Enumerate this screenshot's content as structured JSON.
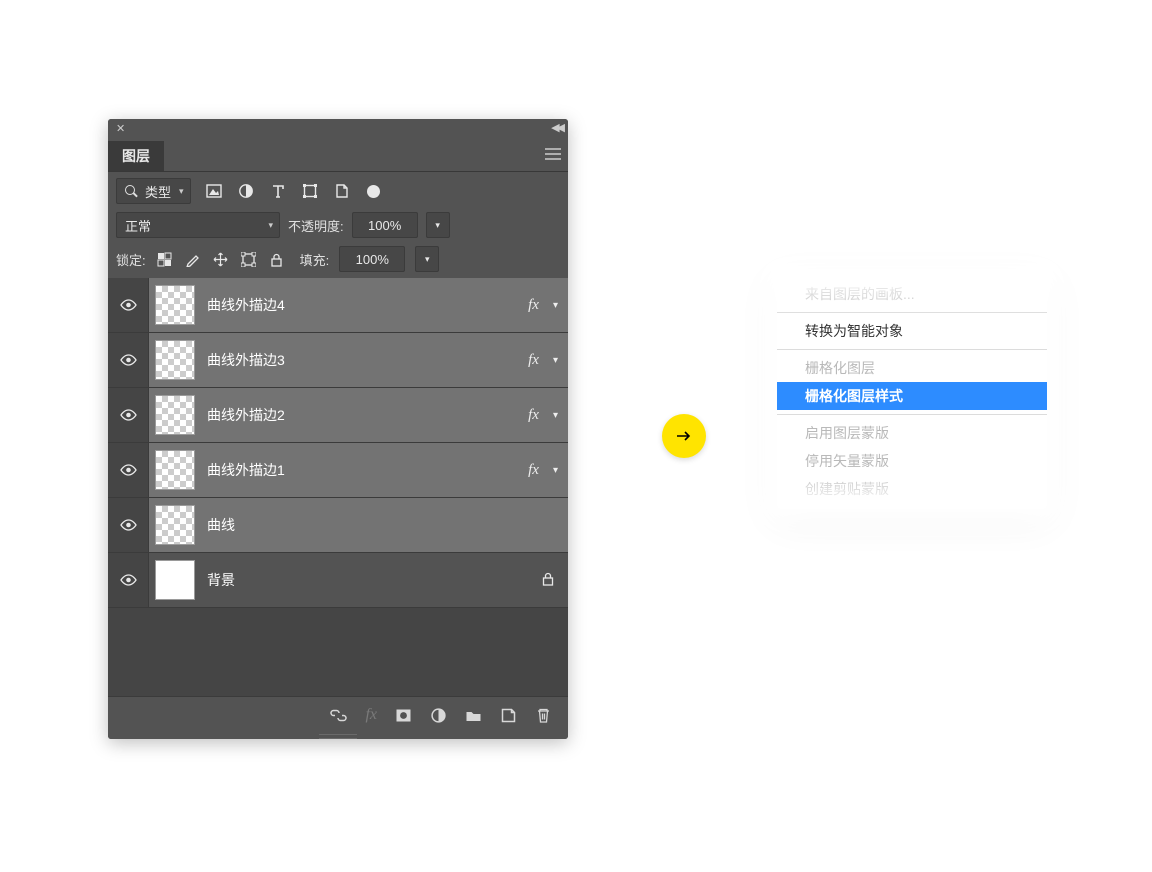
{
  "panel": {
    "title": "图层",
    "filter_label": "类型",
    "blend_mode": "正常",
    "opacity_label": "不透明度:",
    "opacity_value": "100%",
    "lock_label": "锁定:",
    "fill_label": "填充:",
    "fill_value": "100%",
    "layers": [
      {
        "name": "曲线外描边4",
        "fx": true,
        "thumb": "checker",
        "selected": true
      },
      {
        "name": "曲线外描边3",
        "fx": true,
        "thumb": "checker",
        "selected": true
      },
      {
        "name": "曲线外描边2",
        "fx": true,
        "thumb": "checker",
        "selected": true
      },
      {
        "name": "曲线外描边1",
        "fx": true,
        "thumb": "checker",
        "selected": true
      },
      {
        "name": "曲线",
        "fx": false,
        "thumb": "checker",
        "selected": true
      },
      {
        "name": "背景",
        "fx": false,
        "thumb": "white",
        "selected": false,
        "locked": true
      }
    ]
  },
  "context_menu": {
    "items": [
      {
        "label": "来自图层的画板...",
        "state": "disabled"
      },
      {
        "sep": true
      },
      {
        "label": "转换为智能对象",
        "state": "normal"
      },
      {
        "sep": true
      },
      {
        "label": "栅格化图层",
        "state": "disabled"
      },
      {
        "label": "栅格化图层样式",
        "state": "selected"
      },
      {
        "sep": true
      },
      {
        "label": "启用图层蒙版",
        "state": "disabled"
      },
      {
        "label": "停用矢量蒙版",
        "state": "disabled"
      },
      {
        "label": "创建剪贴蒙版",
        "state": "disabled"
      }
    ]
  }
}
